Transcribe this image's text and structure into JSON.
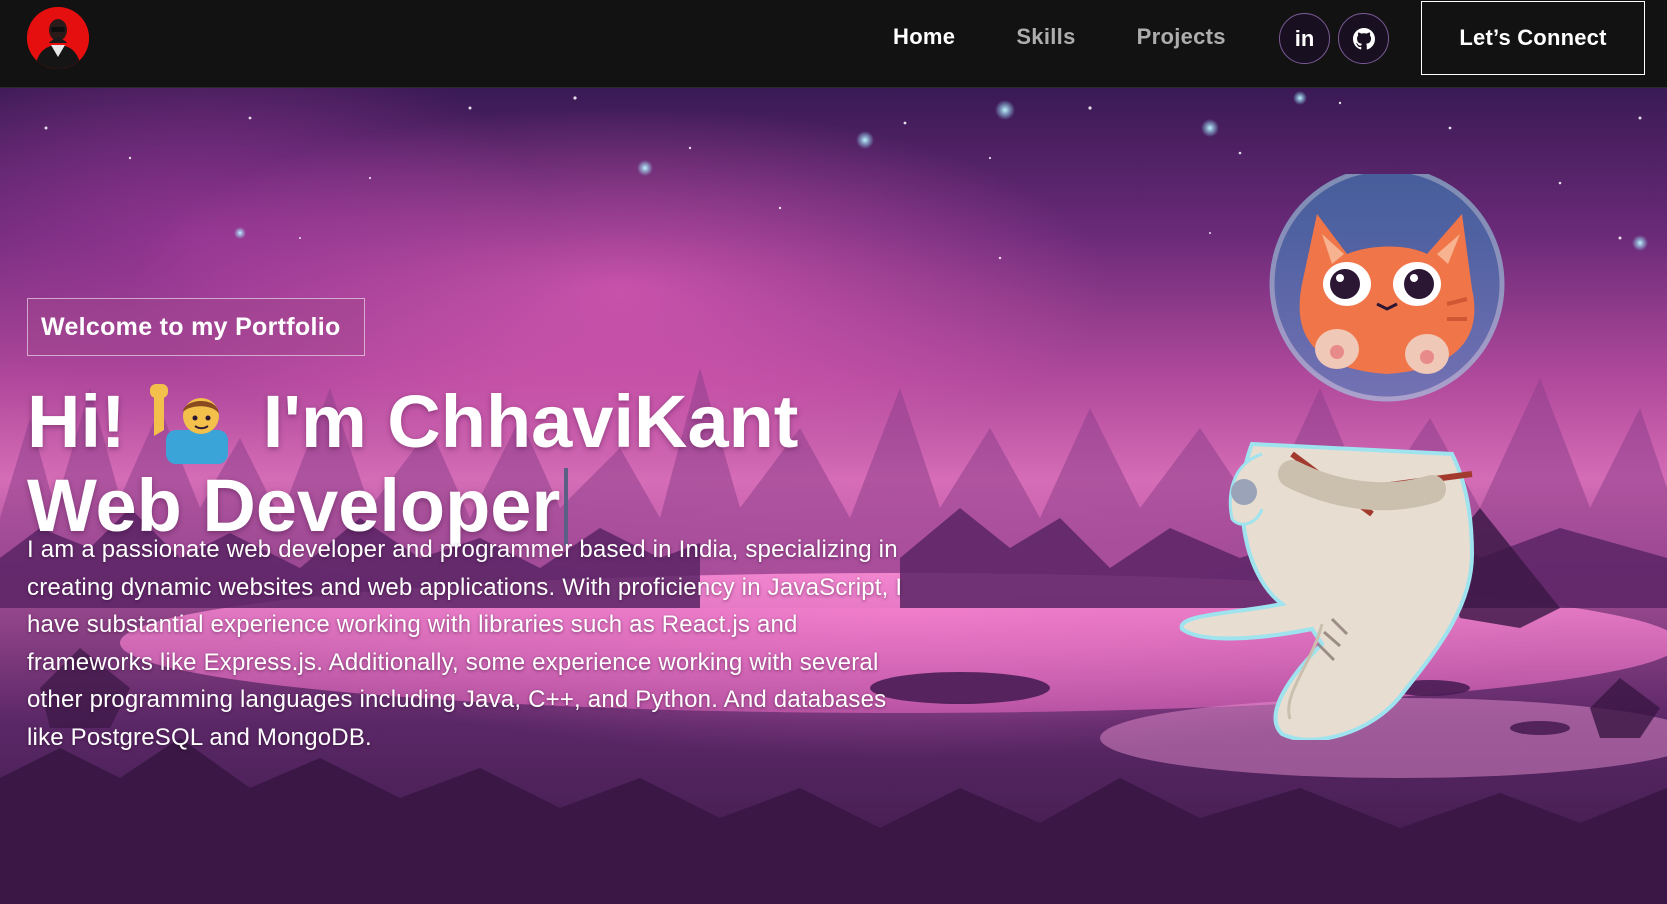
{
  "nav": {
    "links": [
      {
        "label": "Home",
        "active": true
      },
      {
        "label": "Skills",
        "active": false
      },
      {
        "label": "Projects",
        "active": false
      }
    ],
    "social": [
      {
        "name": "linkedin",
        "glyph": "in"
      },
      {
        "name": "github",
        "glyph": "github-icon"
      }
    ],
    "cta_label": "Let’s Connect"
  },
  "hero": {
    "tagline": "Welcome to my Portfolio",
    "greeting_prefix": "Hi!",
    "greeting_name": "I'm ChhaviKant",
    "role": "Web Developer",
    "bio": "I am a passionate web developer and programmer based in India, specializing in creating dynamic websites and web applications. With proficiency in JavaScript, I have substantial experience working with libraries such as React.js and frameworks like Express.js. Additionally, some experience working with several other programming languages including Java, C++, and Python. And databases like PostgreSQL and MongoDB."
  },
  "colors": {
    "nav_bg": "#121212",
    "logo_bg": "#e60f0f",
    "hero_pink": "#d46cb6",
    "hero_purple": "#3a1a55"
  }
}
